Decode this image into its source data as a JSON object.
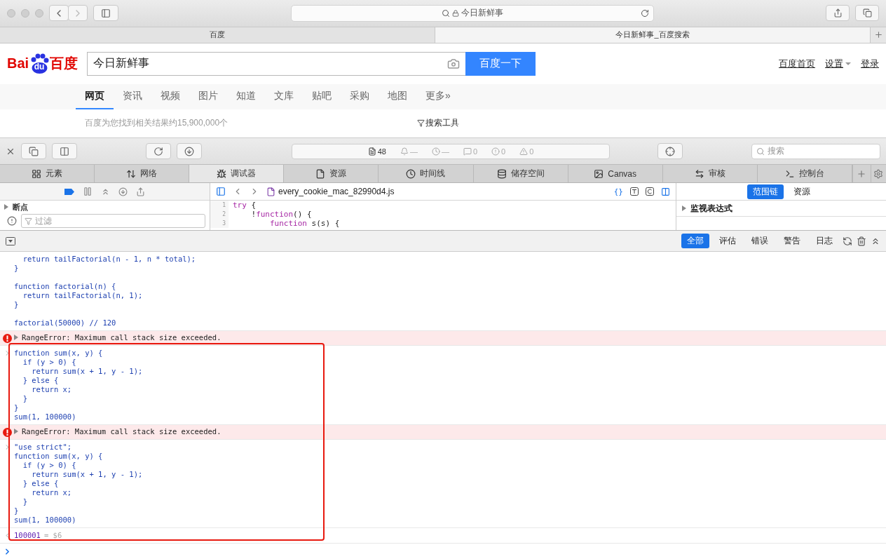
{
  "browser": {
    "address": "今日新鲜事",
    "tabs": [
      {
        "label": "百度",
        "selected": false
      },
      {
        "label": "今日新鲜事_百度搜索",
        "selected": true
      }
    ]
  },
  "baidu": {
    "logo": {
      "left": "Bai",
      "badge": "du",
      "right": "百度"
    },
    "query": "今日新鲜事",
    "search_button": "百度一下",
    "links": [
      {
        "label": "百度首页",
        "dropdown": false
      },
      {
        "label": "设置",
        "dropdown": true
      },
      {
        "label": "登录",
        "dropdown": false
      }
    ],
    "nav": [
      {
        "label": "网页",
        "selected": true
      },
      {
        "label": "资讯",
        "selected": false
      },
      {
        "label": "视频",
        "selected": false
      },
      {
        "label": "图片",
        "selected": false
      },
      {
        "label": "知道",
        "selected": false
      },
      {
        "label": "文库",
        "selected": false
      },
      {
        "label": "贴吧",
        "selected": false
      },
      {
        "label": "采购",
        "selected": false
      },
      {
        "label": "地图",
        "selected": false
      },
      {
        "label": "更多»",
        "selected": false
      }
    ],
    "result_count": "百度为您找到相关结果约15,900,000个",
    "tools": "搜索工具"
  },
  "devtools": {
    "status": [
      {
        "kind": "resources",
        "count": "48"
      },
      {
        "kind": "bell",
        "count": "—"
      },
      {
        "kind": "clock",
        "count": "—"
      },
      {
        "kind": "logs",
        "count": "0"
      },
      {
        "kind": "errors",
        "count": "0"
      },
      {
        "kind": "warnings",
        "count": "0"
      }
    ],
    "search_placeholder": "搜索",
    "tabs": [
      {
        "kind": "elements",
        "label": "元素",
        "selected": false
      },
      {
        "kind": "network",
        "label": "网络",
        "selected": false
      },
      {
        "kind": "debugger",
        "label": "调试器",
        "selected": true
      },
      {
        "kind": "resources",
        "label": "资源",
        "selected": false
      },
      {
        "kind": "timeline",
        "label": "时间线",
        "selected": false
      },
      {
        "kind": "storage",
        "label": "储存空间",
        "selected": false
      },
      {
        "kind": "canvas",
        "label": "Canvas",
        "selected": false
      },
      {
        "kind": "audit",
        "label": "审核",
        "selected": false
      },
      {
        "kind": "console",
        "label": "控制台",
        "selected": false
      }
    ],
    "breakpoints_active": true,
    "breakpoints_label": "断点",
    "filter_placeholder": "过滤",
    "file": "every_cookie_mac_82990d4.js",
    "format_label": "{}",
    "code": [
      {
        "number": "1",
        "tokens": [
          {
            "kind": "keyword",
            "text": "try"
          },
          {
            "kind": "plain",
            "text": " {"
          }
        ]
      },
      {
        "number": "2",
        "tokens": [
          {
            "kind": "plain",
            "text": "    !"
          },
          {
            "kind": "keyword",
            "text": "function"
          },
          {
            "kind": "plain",
            "text": "() {"
          }
        ]
      },
      {
        "number": "3",
        "tokens": [
          {
            "kind": "keyword",
            "text": "        function"
          },
          {
            "kind": "plain",
            "text": " s(s) {"
          }
        ]
      }
    ],
    "sidebar_tabs": [
      {
        "label": "范围链",
        "selected": true
      },
      {
        "label": "资源",
        "selected": false
      }
    ],
    "watch_label": "监视表达式",
    "console_filters": [
      {
        "label": "全部",
        "selected": true
      },
      {
        "label": "评估",
        "selected": false
      },
      {
        "label": "错误",
        "selected": false
      },
      {
        "label": "警告",
        "selected": false
      },
      {
        "label": "日志",
        "selected": false
      }
    ],
    "console": [
      {
        "kind": "fragment",
        "code": "  return tailFactorial(n - 1, n * total);\n}\n\nfunction factorial(n) {\n  return tailFactorial(n, 1);\n}\n\nfactorial(50000) // 120"
      },
      {
        "kind": "error",
        "message": "RangeError: Maximum call stack size exceeded."
      },
      {
        "kind": "input",
        "code": "function sum(x, y) {\n  if (y > 0) {\n    return sum(x + 1, y - 1);\n  } else {\n    return x;\n  }\n}\nsum(1, 100000)"
      },
      {
        "kind": "error",
        "message": "RangeError: Maximum call stack size exceeded."
      },
      {
        "kind": "input",
        "code": "\"use strict\";\nfunction sum(x, y) {\n  if (y > 0) {\n    return sum(x + 1, y - 1);\n  } else {\n    return x;\n  }\n}\nsum(1, 100000)"
      },
      {
        "kind": "result",
        "value": "100001",
        "ref": "= $6"
      }
    ]
  }
}
